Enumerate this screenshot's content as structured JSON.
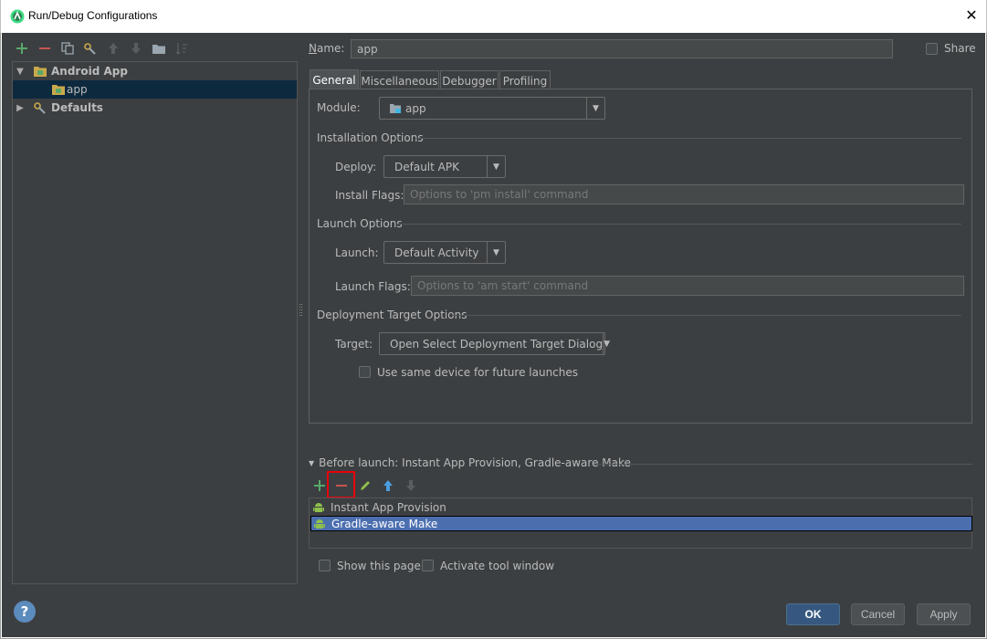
{
  "window": {
    "title": "Run/Debug Configurations",
    "close_glyph": "✕"
  },
  "tree": {
    "items": [
      {
        "label": "Android App",
        "expanded": true
      },
      {
        "label": "app",
        "selected": true
      },
      {
        "label": "Defaults",
        "expanded": false
      }
    ]
  },
  "name_field": {
    "label_prefix": "N",
    "label_rest": "ame:",
    "value": "app"
  },
  "share": {
    "label": "Share"
  },
  "tabs": [
    {
      "label": "General",
      "active": true
    },
    {
      "label": "Miscellaneous"
    },
    {
      "label": "Debugger"
    },
    {
      "label": "Profiling"
    }
  ],
  "general": {
    "module_label": "Module:",
    "module_value": "app",
    "installation_title": "Installation Options",
    "deploy_label": "Deploy:",
    "deploy_value": "Default APK",
    "install_flags_label": "Install Flags:",
    "install_flags_placeholder": "Options to 'pm install' command",
    "launch_title": "Launch Options",
    "launch_label": "Launch:",
    "launch_value": "Default Activity",
    "launch_flags_label": "Launch Flags:",
    "launch_flags_placeholder": "Options to 'am start' command",
    "deployment_title": "Deployment Target Options",
    "target_label": "Target:",
    "target_value": "Open Select Deployment Target Dialog",
    "same_device_label": "Use same device for future launches"
  },
  "before_launch": {
    "title": "Before launch: Instant App Provision, Gradle-aware Make",
    "items": [
      {
        "label": "Instant App Provision"
      },
      {
        "label": "Gradle-aware Make",
        "selected": true
      }
    ]
  },
  "bottom": {
    "show_page_label": "Show this page",
    "activate_tool_label": "Activate tool window"
  },
  "buttons": {
    "ok": "OK",
    "cancel": "Cancel",
    "apply": "Apply",
    "help": "?"
  },
  "colors": {
    "accent": "#365880",
    "selection": "#4b6eaf",
    "highlight": "#e8000b",
    "add_green": "#59a869",
    "remove_red": "#c75450"
  }
}
